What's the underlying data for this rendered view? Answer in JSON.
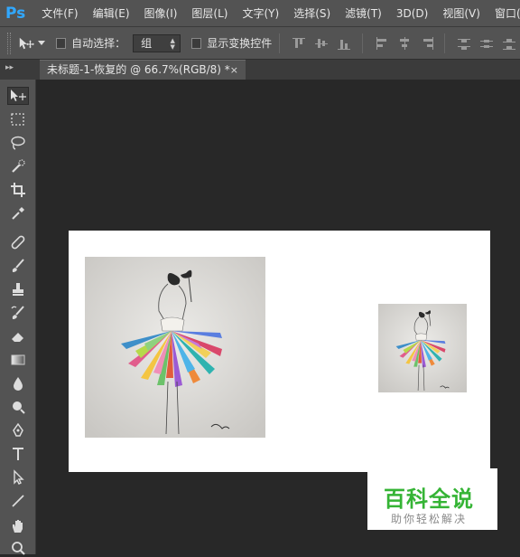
{
  "app": {
    "logo": "Ps"
  },
  "menu": [
    "文件(F)",
    "编辑(E)",
    "图像(I)",
    "图层(L)",
    "文字(Y)",
    "选择(S)",
    "滤镜(T)",
    "3D(D)",
    "视图(V)",
    "窗口(W)"
  ],
  "options": {
    "auto_select_label": "自动选择：",
    "auto_select_value": "组",
    "show_transform_label": "显示变换控件"
  },
  "document_tab": {
    "title": "未标题-1-恢复的 @ 66.7%(RGB/8) *",
    "close_glyph": "×"
  },
  "tools": [
    "move-icon",
    "marquee-icon",
    "lasso-icon",
    "quick-select-icon",
    "crop-icon",
    "eyedropper-icon",
    "healing-icon",
    "brush-icon",
    "stamp-icon",
    "history-brush-icon",
    "eraser-icon",
    "gradient-icon",
    "blur-icon",
    "dodge-icon",
    "pen-icon",
    "type-icon",
    "path-select-icon",
    "line-icon",
    "hand-icon",
    "zoom-icon"
  ],
  "watermark": {
    "title": "百科全说",
    "subtitle": "助你轻松解决"
  },
  "colors": {
    "chrome": "#535353",
    "workspace": "#282828",
    "ps_blue": "#31a8ff",
    "watermark_green": "#35b435"
  }
}
